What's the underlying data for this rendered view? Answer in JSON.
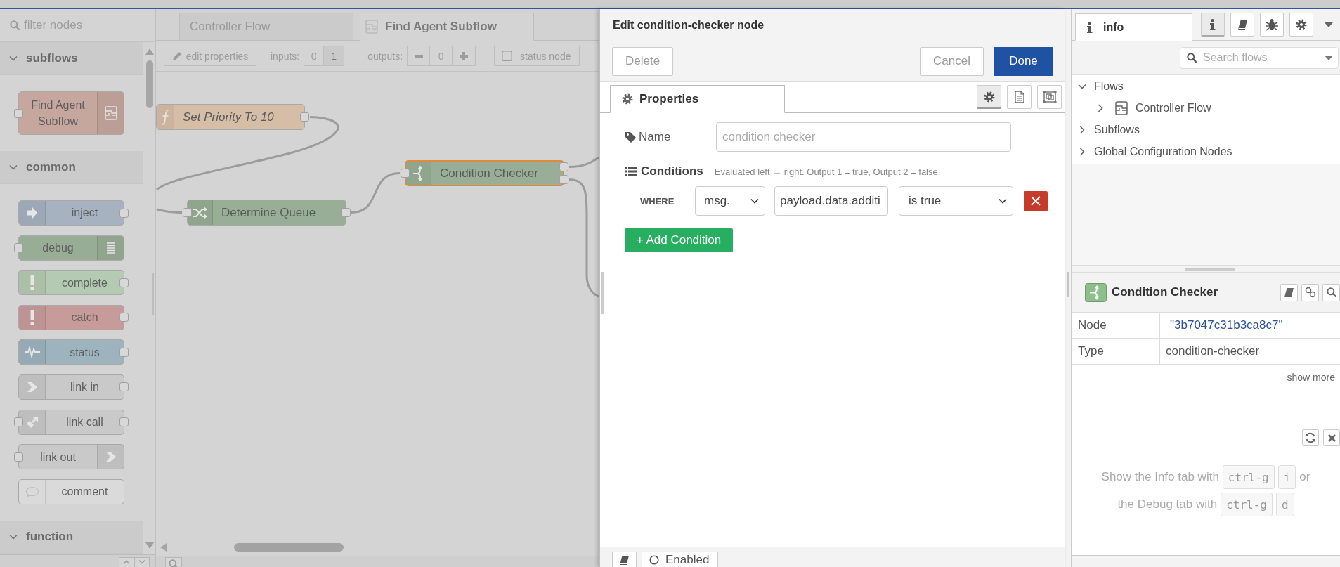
{
  "palette": {
    "filter_placeholder": "filter nodes",
    "categories": [
      {
        "name": "subflows",
        "expanded": true,
        "nodes": [
          {
            "label": "Find Agent Subflow",
            "kind": "subflow",
            "color": "#c6a79d"
          }
        ]
      },
      {
        "name": "common",
        "expanded": true,
        "nodes": [
          {
            "label": "inject",
            "kind": "inject",
            "color": "#a6b2c0"
          },
          {
            "label": "debug",
            "kind": "debug",
            "color": "#98ad96"
          },
          {
            "label": "complete",
            "kind": "complete",
            "color": "#b5cab3"
          },
          {
            "label": "catch",
            "kind": "catch",
            "color": "#c89b9b"
          },
          {
            "label": "status",
            "kind": "status",
            "color": "#9db4be"
          },
          {
            "label": "link in",
            "kind": "linkin",
            "color": "#c9c9c9"
          },
          {
            "label": "link call",
            "kind": "linkcall",
            "color": "#c9c9c9"
          },
          {
            "label": "link out",
            "kind": "linkout",
            "color": "#c9c9c9"
          },
          {
            "label": "comment",
            "kind": "comment",
            "color": "#dadada"
          }
        ]
      },
      {
        "name": "function",
        "expanded": true
      }
    ]
  },
  "workspace": {
    "tabs": [
      {
        "label": "Controller Flow",
        "kind": "flow",
        "selected": false
      },
      {
        "label": "Find Agent Subflow",
        "kind": "subflow",
        "selected": true
      }
    ],
    "toolbar": {
      "edit_button": "edit properties",
      "inputs_label": "inputs:",
      "inputs": [
        {
          "label": "0",
          "selected": false
        },
        {
          "label": "1",
          "selected": true
        }
      ],
      "outputs_label": "outputs:",
      "outputs_value": "0",
      "status_node": {
        "label": "status node",
        "checked": false
      }
    },
    "nodes": [
      {
        "label": "Set Priority To 10",
        "kind": "function",
        "color": "#d6bda6",
        "italic": true,
        "selected": false
      },
      {
        "label": "Determine Queue",
        "kind": "shuffle",
        "color": "#98ae96",
        "italic": false,
        "selected": false
      },
      {
        "label": "Condition Checker",
        "kind": "condition",
        "color": "#98ae96",
        "italic": false,
        "selected": true
      }
    ]
  },
  "dialog": {
    "title": "Edit condition-checker node",
    "buttons": {
      "delete": "Delete",
      "cancel": "Cancel",
      "done": "Done"
    },
    "tabs": [
      {
        "label": "Properties",
        "selected": true
      }
    ],
    "icon_tabs": [
      {
        "kind": "settings",
        "selected": true
      },
      {
        "kind": "notes",
        "selected": false
      },
      {
        "kind": "appearance",
        "selected": false
      }
    ],
    "name": {
      "label": "Name",
      "placeholder": "condition checker"
    },
    "conditions": {
      "label": "Conditions",
      "hint": "Evaluated left → right. Output 1 = true, Output 2 = false.",
      "rows": [
        {
          "keyword": "WHERE",
          "source": "msg.",
          "path": "payload.data.additi",
          "operator": "is true"
        }
      ],
      "add_button": "+ Add Condition"
    },
    "footer": {
      "enabled": "Enabled"
    }
  },
  "sidebar": {
    "tabs": [
      {
        "label": "info",
        "selected": true
      }
    ],
    "tab_buttons": [
      {
        "kind": "info",
        "selected": true
      },
      {
        "kind": "help",
        "selected": false
      },
      {
        "kind": "debug",
        "selected": false
      },
      {
        "kind": "config",
        "selected": false
      }
    ],
    "search_placeholder": "Search flows",
    "tree": [
      {
        "label": "Flows",
        "kind": "group",
        "expanded": true,
        "children": [
          {
            "label": "Controller Flow",
            "kind": "flow",
            "expanded": false
          }
        ]
      },
      {
        "label": "Subflows",
        "kind": "group",
        "expanded": false
      },
      {
        "label": "Global Configuration Nodes",
        "kind": "group",
        "expanded": false
      }
    ],
    "node": {
      "title": "Condition Checker",
      "properties": [
        {
          "key": "Node",
          "value": "\"3b7047c31b3ca8c7\"",
          "kind": "id"
        },
        {
          "key": "Type",
          "value": "condition-checker",
          "kind": "text"
        }
      ],
      "show_more": "show more"
    },
    "help": {
      "lines": [
        {
          "parts": [
            {
              "kind": "text",
              "text": "Show the Info tab with"
            },
            {
              "kind": "key",
              "text": "ctrl-g"
            },
            {
              "kind": "key",
              "text": "i"
            },
            {
              "kind": "text",
              "text": "or"
            }
          ]
        },
        {
          "parts": [
            {
              "kind": "text",
              "text": "the Debug tab with"
            },
            {
              "kind": "key",
              "text": "ctrl-g"
            },
            {
              "kind": "key",
              "text": "d"
            }
          ]
        }
      ]
    }
  }
}
